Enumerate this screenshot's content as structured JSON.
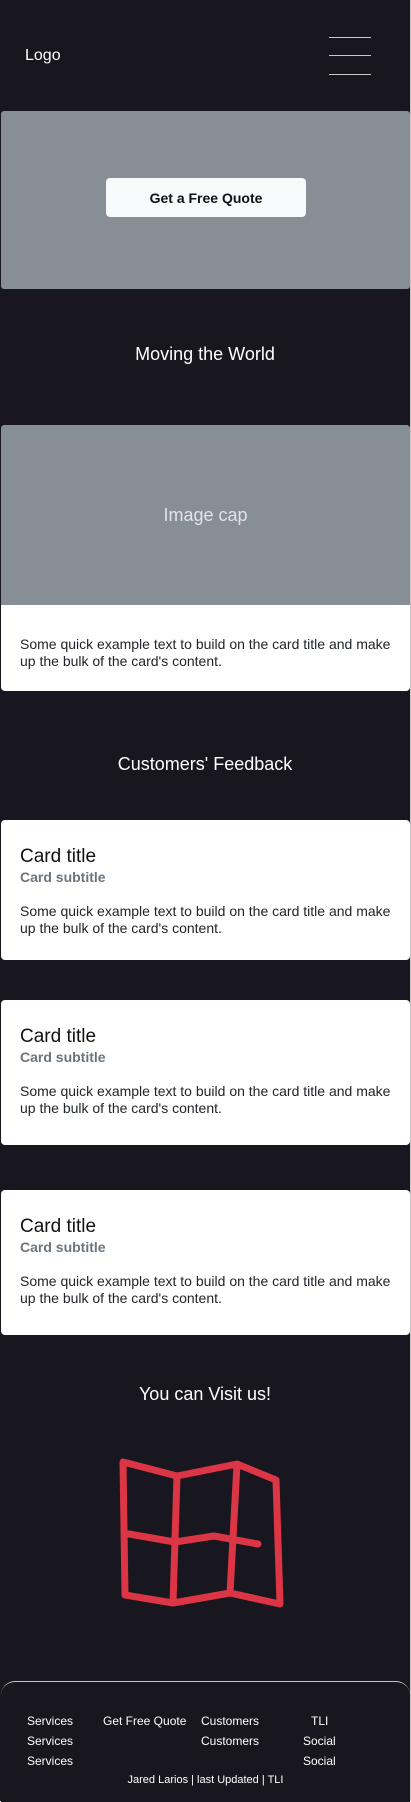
{
  "navbar": {
    "logo": "Logo",
    "menu_icon": "hamburger-menu-icon"
  },
  "hero": {
    "cta_label": "Get a Free Quote"
  },
  "section_moving": {
    "heading": "Moving the World"
  },
  "image_card": {
    "image_cap": "Image cap",
    "text": "Some quick example text to build on the card title and make up the bulk of the card's content."
  },
  "feedback": {
    "heading": "Customers' Feedback",
    "cards": [
      {
        "title": "Card title",
        "subtitle": "Card subtitle",
        "text": "Some quick example text to build on the card title and make up the bulk of the card's content."
      },
      {
        "title": "Card title",
        "subtitle": "Card subtitle",
        "text": "Some quick example text to build on the card title and make up the bulk of the card's content."
      },
      {
        "title": "Card title",
        "subtitle": "Card subtitle",
        "text": "Some quick example text to build on the card title and make up the bulk of the card's content."
      }
    ]
  },
  "visit": {
    "heading": "You can Visit us!",
    "icon": "map-icon",
    "icon_color": "#dc3545"
  },
  "footer": {
    "col1": [
      "Services",
      "Services",
      "Services"
    ],
    "col2": [
      "Get Free Quote"
    ],
    "col3": [
      "Customers",
      "Customers"
    ],
    "col4": [
      "TLI",
      "Social",
      "Social"
    ],
    "credit": "Jared Larios | last Updated | TLI"
  }
}
